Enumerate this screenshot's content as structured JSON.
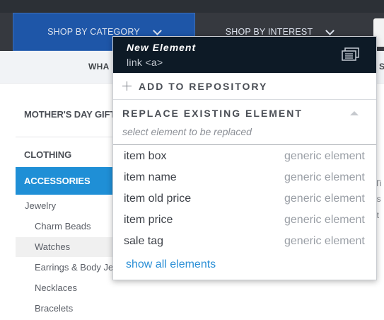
{
  "nav": {
    "tab_category": "SHOP BY CATEGORY",
    "tab_interest": "SHOP BY INTEREST"
  },
  "subnav": {
    "left_fragment": "WHA",
    "right_fragment": "SI"
  },
  "sidebar": {
    "mothers_day": "MOTHER'S DAY GIFT",
    "clothing": "CLOTHING",
    "accessories": "ACCESSORIES",
    "jewelry": "Jewelry",
    "items": [
      "Charm Beads",
      "Watches",
      "Earrings & Body Jewelry",
      "Necklaces",
      "Bracelets"
    ]
  },
  "right_peek": [
    "Ti",
    "is",
    "it"
  ],
  "popup": {
    "title": "New Element",
    "subtitle": "link <a>",
    "header_icon": "repository-icon",
    "add_label": "ADD TO REPOSITORY",
    "replace_heading": "REPLACE EXISTING ELEMENT",
    "replace_hint": "select element to be replaced",
    "elements": [
      {
        "name": "item box",
        "type": "generic element"
      },
      {
        "name": "item name",
        "type": "generic element"
      },
      {
        "name": "item old price",
        "type": "generic element"
      },
      {
        "name": "item price",
        "type": "generic element"
      },
      {
        "name": "sale tag",
        "type": "generic element"
      }
    ],
    "show_all": "show all elements"
  },
  "colors": {
    "nav_background": "#36393f",
    "nav_active": "#1e56a8",
    "sidebar_active": "#1f8fd6",
    "popup_header": "#0d1a26",
    "link": "#2b8fd6"
  }
}
